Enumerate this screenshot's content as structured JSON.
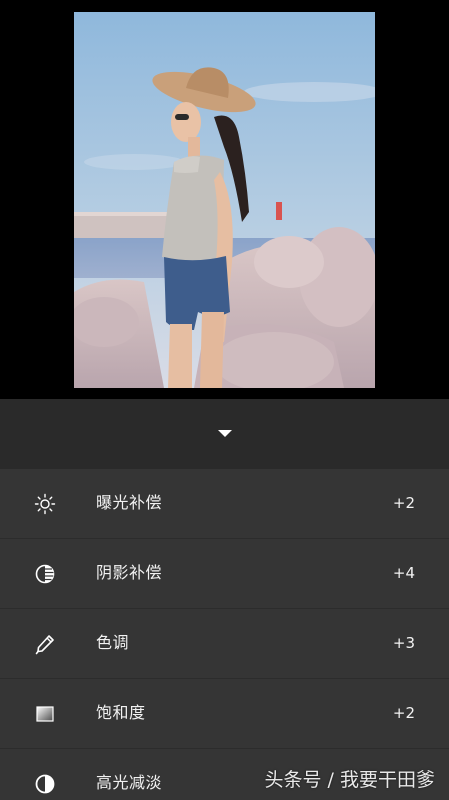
{
  "panel": {
    "collapse_icon": "chevron-down-icon"
  },
  "adjustments": [
    {
      "icon": "sun-icon",
      "label": "曝光补偿",
      "value": "+2"
    },
    {
      "icon": "shadow-circle-icon",
      "label": "阴影补偿",
      "value": "+4"
    },
    {
      "icon": "pen-icon",
      "label": "色调",
      "value": "+3"
    },
    {
      "icon": "gradient-square-icon",
      "label": "饱和度",
      "value": "+2"
    },
    {
      "icon": "half-circle-icon",
      "label": "高光减淡",
      "value": ""
    }
  ],
  "watermark": "头条号 / 我要干田爹"
}
